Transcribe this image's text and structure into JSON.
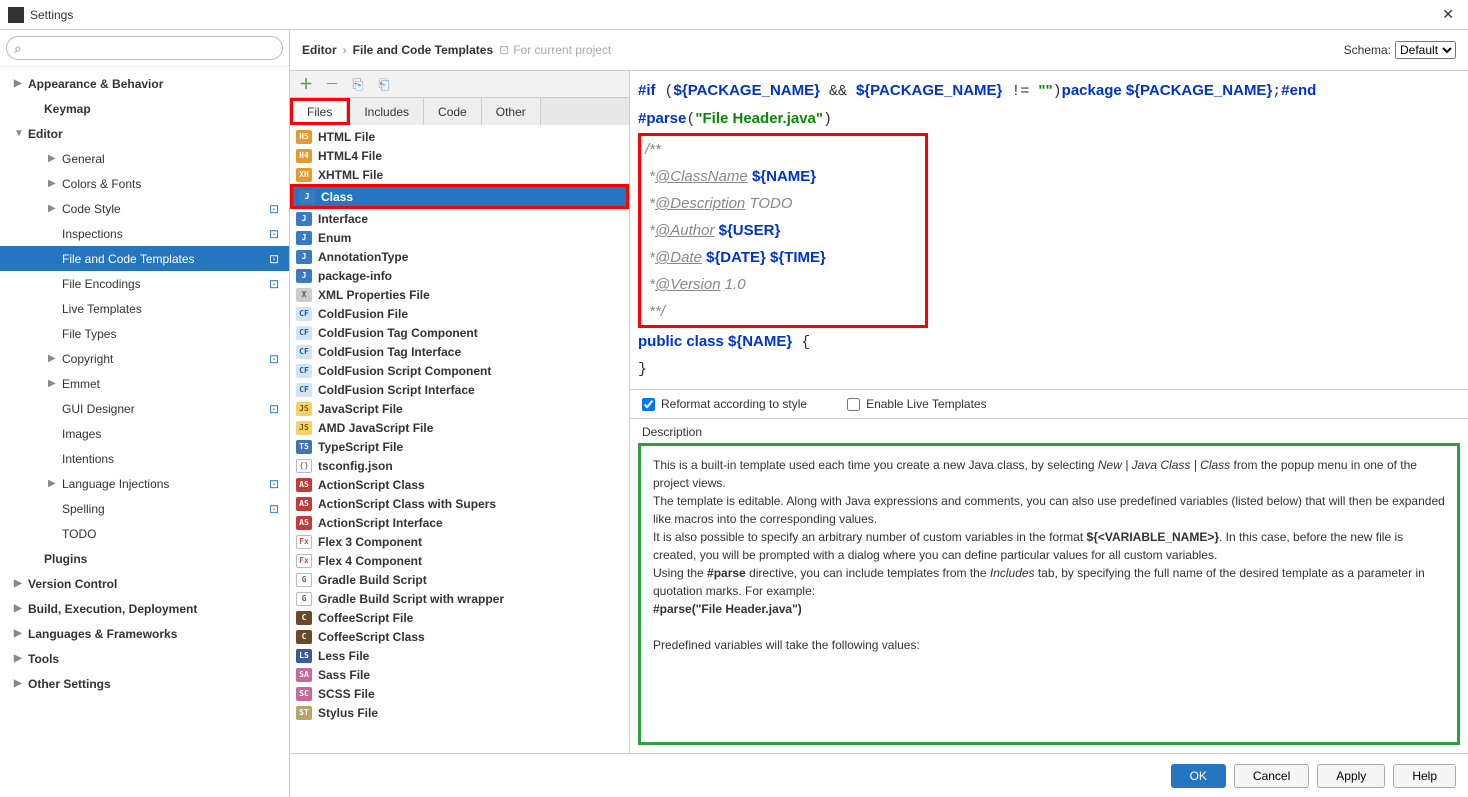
{
  "window": {
    "title": "Settings"
  },
  "sidebar": {
    "search_placeholder": "",
    "items": [
      {
        "label": "Appearance & Behavior",
        "level": 0,
        "arrow": "▶",
        "badge": ""
      },
      {
        "label": "Keymap",
        "level": 1,
        "arrow": "",
        "badge": ""
      },
      {
        "label": "Editor",
        "level": 0,
        "arrow": "▼",
        "badge": ""
      },
      {
        "label": "General",
        "level": 2,
        "arrow": "▶",
        "badge": ""
      },
      {
        "label": "Colors & Fonts",
        "level": 2,
        "arrow": "▶",
        "badge": ""
      },
      {
        "label": "Code Style",
        "level": 2,
        "arrow": "▶",
        "badge": "⊡"
      },
      {
        "label": "Inspections",
        "level": 2,
        "arrow": "",
        "badge": "⊡"
      },
      {
        "label": "File and Code Templates",
        "level": 2,
        "arrow": "",
        "badge": "⊡",
        "selected": true
      },
      {
        "label": "File Encodings",
        "level": 2,
        "arrow": "",
        "badge": "⊡"
      },
      {
        "label": "Live Templates",
        "level": 2,
        "arrow": "",
        "badge": ""
      },
      {
        "label": "File Types",
        "level": 2,
        "arrow": "",
        "badge": ""
      },
      {
        "label": "Copyright",
        "level": 2,
        "arrow": "▶",
        "badge": "⊡"
      },
      {
        "label": "Emmet",
        "level": 2,
        "arrow": "▶",
        "badge": ""
      },
      {
        "label": "GUI Designer",
        "level": 2,
        "arrow": "",
        "badge": "⊡"
      },
      {
        "label": "Images",
        "level": 2,
        "arrow": "",
        "badge": ""
      },
      {
        "label": "Intentions",
        "level": 2,
        "arrow": "",
        "badge": ""
      },
      {
        "label": "Language Injections",
        "level": 2,
        "arrow": "▶",
        "badge": "⊡"
      },
      {
        "label": "Spelling",
        "level": 2,
        "arrow": "",
        "badge": "⊡"
      },
      {
        "label": "TODO",
        "level": 2,
        "arrow": "",
        "badge": ""
      },
      {
        "label": "Plugins",
        "level": 1,
        "arrow": "",
        "badge": ""
      },
      {
        "label": "Version Control",
        "level": 0,
        "arrow": "▶",
        "badge": ""
      },
      {
        "label": "Build, Execution, Deployment",
        "level": 0,
        "arrow": "▶",
        "badge": ""
      },
      {
        "label": "Languages & Frameworks",
        "level": 0,
        "arrow": "▶",
        "badge": ""
      },
      {
        "label": "Tools",
        "level": 0,
        "arrow": "▶",
        "badge": ""
      },
      {
        "label": "Other Settings",
        "level": 0,
        "arrow": "▶",
        "badge": ""
      }
    ]
  },
  "breadcrumb": {
    "a": "Editor",
    "b": "File and Code Templates",
    "sub": "For current project"
  },
  "schema": {
    "label": "Schema:",
    "value": "Default"
  },
  "tabs": [
    "Files",
    "Includes",
    "Code",
    "Other"
  ],
  "templates": [
    {
      "label": "HTML File",
      "icon": "H5",
      "bg": "#e39a2f",
      "fg": "#fff"
    },
    {
      "label": "HTML4 File",
      "icon": "H4",
      "bg": "#e39a2f",
      "fg": "#fff"
    },
    {
      "label": "XHTML File",
      "icon": "XH",
      "bg": "#e39a2f",
      "fg": "#fff"
    },
    {
      "label": "Class",
      "icon": "J",
      "bg": "#3a7bbf",
      "fg": "#fff",
      "selected": true
    },
    {
      "label": "Interface",
      "icon": "J",
      "bg": "#3a7bbf",
      "fg": "#fff"
    },
    {
      "label": "Enum",
      "icon": "J",
      "bg": "#3a7bbf",
      "fg": "#fff"
    },
    {
      "label": "AnnotationType",
      "icon": "J",
      "bg": "#3a7bbf",
      "fg": "#fff"
    },
    {
      "label": "package-info",
      "icon": "J",
      "bg": "#3a7bbf",
      "fg": "#fff"
    },
    {
      "label": "XML Properties File",
      "icon": "X",
      "bg": "#ccc",
      "fg": "#555"
    },
    {
      "label": "ColdFusion File",
      "icon": "CF",
      "bg": "#cfe5f6",
      "fg": "#2b5a85"
    },
    {
      "label": "ColdFusion Tag Component",
      "icon": "CF",
      "bg": "#cfe5f6",
      "fg": "#2b5a85"
    },
    {
      "label": "ColdFusion Tag Interface",
      "icon": "CF",
      "bg": "#cfe5f6",
      "fg": "#2b5a85"
    },
    {
      "label": "ColdFusion Script Component",
      "icon": "CF",
      "bg": "#cfe5f6",
      "fg": "#2b5a85"
    },
    {
      "label": "ColdFusion Script Interface",
      "icon": "CF",
      "bg": "#cfe5f6",
      "fg": "#2b5a85"
    },
    {
      "label": "JavaScript File",
      "icon": "JS",
      "bg": "#f2d26b",
      "fg": "#7a5c00"
    },
    {
      "label": "AMD JavaScript File",
      "icon": "JS",
      "bg": "#f2d26b",
      "fg": "#7a5c00"
    },
    {
      "label": "TypeScript File",
      "icon": "TS",
      "bg": "#4073b0",
      "fg": "#fff"
    },
    {
      "label": "tsconfig.json",
      "icon": "{}",
      "bg": "#fff",
      "fg": "#888"
    },
    {
      "label": "ActionScript Class",
      "icon": "AS",
      "bg": "#c23a3a",
      "fg": "#fff"
    },
    {
      "label": "ActionScript Class with Supers",
      "icon": "AS",
      "bg": "#c23a3a",
      "fg": "#fff"
    },
    {
      "label": "ActionScript Interface",
      "icon": "AS",
      "bg": "#c23a3a",
      "fg": "#fff"
    },
    {
      "label": "Flex 3 Component",
      "icon": "Fx",
      "bg": "#fff",
      "fg": "#b55"
    },
    {
      "label": "Flex 4 Component",
      "icon": "Fx",
      "bg": "#fff",
      "fg": "#b55"
    },
    {
      "label": "Gradle Build Script",
      "icon": "G",
      "bg": "#fff",
      "fg": "#3a7f3a"
    },
    {
      "label": "Gradle Build Script with wrapper",
      "icon": "G",
      "bg": "#fff",
      "fg": "#3a7f3a"
    },
    {
      "label": "CoffeeScript File",
      "icon": "C",
      "bg": "#6a4a2a",
      "fg": "#fff"
    },
    {
      "label": "CoffeeScript Class",
      "icon": "C",
      "bg": "#6a4a2a",
      "fg": "#fff"
    },
    {
      "label": "Less File",
      "icon": "LS",
      "bg": "#3a5a9f",
      "fg": "#fff"
    },
    {
      "label": "Sass File",
      "icon": "SA",
      "bg": "#c66a9a",
      "fg": "#fff"
    },
    {
      "label": "SCSS File",
      "icon": "SC",
      "bg": "#c66a9a",
      "fg": "#fff"
    },
    {
      "label": "Stylus File",
      "icon": "ST",
      "bg": "#b7a56a",
      "fg": "#fff"
    }
  ],
  "checks": {
    "reformat": "Reformat according to style",
    "live": "Enable Live Templates"
  },
  "desc_label": "Description",
  "buttons": {
    "ok": "OK",
    "cancel": "Cancel",
    "apply": "Apply",
    "help": "Help"
  }
}
